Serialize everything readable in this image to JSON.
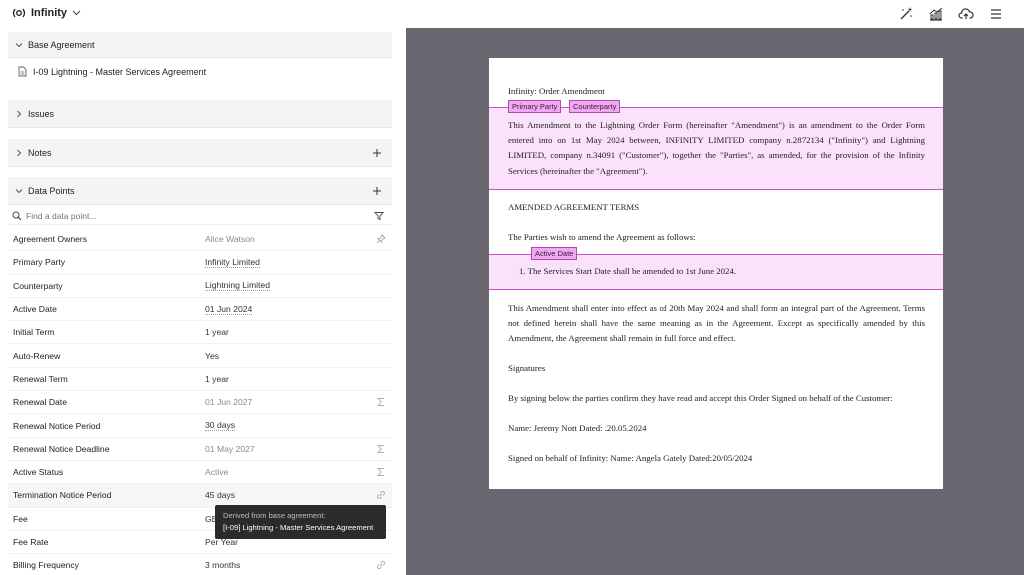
{
  "app": {
    "name": "Infinity"
  },
  "sections": {
    "base_agreement": "Base Agreement",
    "base_agreement_doc": "I-09 Lightning - Master Services Agreement",
    "issues": "Issues",
    "notes": "Notes",
    "data_points": "Data Points"
  },
  "search": {
    "placeholder": "Find a data point..."
  },
  "rows": [
    {
      "label": "Agreement Owners",
      "value": "Alice Watson"
    },
    {
      "label": "Primary Party",
      "value": "Infinity Limited"
    },
    {
      "label": "Counterparty",
      "value": "Lightning Limited"
    },
    {
      "label": "Active Date",
      "value": "01 Jun 2024"
    },
    {
      "label": "Initial Term",
      "value": "1 year"
    },
    {
      "label": "Auto-Renew",
      "value": "Yes"
    },
    {
      "label": "Renewal Term",
      "value": "1 year"
    },
    {
      "label": "Renewal Date",
      "value": "01 Jun 2027"
    },
    {
      "label": "Renewal Notice Period",
      "value": "30 days"
    },
    {
      "label": "Renewal Notice Deadline",
      "value": "01 May 2027"
    },
    {
      "label": "Active Status",
      "value": "Active"
    },
    {
      "label": "Termination Notice Period",
      "value": "45 days"
    },
    {
      "label": "Fee",
      "value": "GB"
    },
    {
      "label": "Fee Rate",
      "value": "Per Year"
    },
    {
      "label": "Billing Frequency",
      "value": "3 months"
    }
  ],
  "tooltip": {
    "line1": "Derived from base agreement:",
    "line2": "[I-09] Lightning - Master Services Agreement"
  },
  "document": {
    "title": "Infinity: Order Amendment",
    "tags": {
      "primary_party": "Primary Party",
      "counterparty": "Counterparty",
      "active_date": "Active Date"
    },
    "para1": "This Amendment to the Lightning Order Form (hereinafter \"Amendment\") is an amendment to the Order Form entered into on 1st May 2024 between, INFINITY LIMITED company n.2872134 (\"Infinity\") and Lightning LIMITED, company n.34091 (\"Customer\"), together the \"Parties\", as amended, for the provision of the Infinity Services (hereinafter the \"Agreement\").",
    "heading": "AMENDED AGREEMENT TERMS",
    "intro": "The Parties wish to amend the Agreement as follows:",
    "item1": "1.  The Services Start Date shall be amended to 1st June 2024.",
    "para2": "This Amendment shall enter into effect as of 20th May 2024 and shall form an integral part of the Agreement. Terms not defined herein shall have the same meaning as in the Agreement. Except as specifically amended by this Amendment, the Agreement shall remain in full force and effect.",
    "signatures": "Signatures",
    "signing": "By signing below the parties confirm they have read and accept this Order Signed on behalf of the Customer:",
    "name1": "Name: Jeremy Nott Dated: .20.05.2024",
    "name2": "Signed on behalf of Infinity: Name: Angela Gately Dated:20/05/2024"
  }
}
